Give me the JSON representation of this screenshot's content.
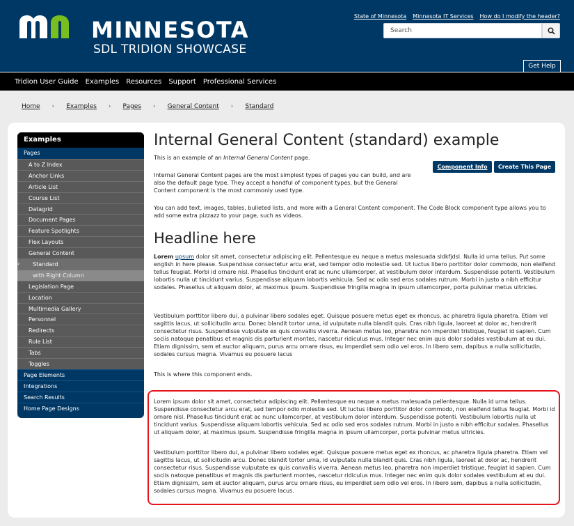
{
  "header": {
    "brand_name": "MINNESOTA",
    "brand_sub": "SDL TRIDION SHOWCASE",
    "util_links": [
      "State of Minnesota",
      "Minnesota IT Services",
      "How do I modify the header?"
    ],
    "search_placeholder": "Search",
    "get_help": "Get Help",
    "logo_colors": {
      "m": "#ffffff",
      "n": "#78be20"
    }
  },
  "nav": [
    "Tridion User Guide",
    "Examples",
    "Resources",
    "Support",
    "Professional Services"
  ],
  "breadcrumb": [
    "Home",
    "Examples",
    "Pages",
    "General Content",
    "Standard"
  ],
  "sidebar": {
    "heading": "Examples",
    "pages": "Pages",
    "sub_items": [
      "A to Z Index",
      "Anchor Links",
      "Article List",
      "Course List",
      "Datagrid",
      "Document Pages",
      "Feature Spotlights",
      "Flex Layouts",
      "General Content"
    ],
    "current": "Standard",
    "current_child": "with Right Column",
    "more_items": [
      "Legislation Page",
      "Location",
      "Multimedia Gallery",
      "Personnel",
      "Redirects",
      "Rule List",
      "Tabs",
      "Toggles"
    ],
    "top_items": [
      "Page Elements",
      "Integrations",
      "Search Results",
      "Home Page Designs"
    ]
  },
  "content": {
    "title": "Internal General Content (standard) example",
    "intro_prefix": "This is an example of an ",
    "intro_italic": "Internal General Content",
    "intro_suffix": " page.",
    "desc": "Internal General Content pages are the most simplest types of pages you can build, and are also the default page type. They accept a handful of component types, but the General Content component is the most commonly used type.",
    "component_info_btn": "Component Info",
    "create_page_btn": "Create This Page",
    "add_text": "You can add text, images, tables, bulleted lists, and more with a General Content component. The Code Block component type allows you to add some extra pizzazz to your page, such as videos.",
    "headline": "Headline here",
    "lorem_bold": "Lorem",
    "lorem_link": "upsum",
    "lorem_rest": " dolor sit amet, consectetur adipiscing elit. Pellentesque eu neque a metus malesuada sldkfjdsl. Nulla id urna tellus.  Put some english in here please. Suspendisse consectetur arcu erat, sed tempor odio molestie sed. Ut luctus libero porttitor dolor commodo, non eleifend tellus feugiat. Morbi id ornare nisl. Phasellus tincidunt erat ac nunc ullamcorper, at vestibulum dolor interdum. Suspendisse potenti. Vestibulum lobortis nulla ut tincidunt varius. Suspendisse aliquam lobortis vehicula. Sed ac odio sed eros sodales rutrum. Morbi in justo a nibh efficitur sodales. Phasellus ut aliquam dolor, at maximus ipsum. Suspendisse fringilla magna in ipsum ullamcorper, porta pulvinar metus ultricies.",
    "vestibulum": "Vestibulum porttitor libero dui, a pulvinar libero sodales eget. Quisque posuere metus eget ex rhoncus, ac pharetra ligula pharetra. Etiam vel sagittis lacus, ut sollicitudin arcu. Donec blandit tortor urna, id vulputate nulla blandit quis. Cras nibh ligula, laoreet at dolor ac, hendrerit consectetur risus. Suspendisse vulputate ex quis convallis viverra. Aenean metus leo, pharetra non imperdiet tristique, feugiat id sapien. Cum sociis natoque penatibus et magnis dis parturient montes, nascetur ridiculus mus. Integer nec enim quis dolor sodales vestibulum at eu dui. Etiam dignissim, sem et auctor aliquam, purus arcu ornare risus, eu imperdiet sem odio vel eros. In libero sem, dapibus a nulla sollicitudin, sodales cursus magna. Vivamus eu posuere lacus",
    "component_ends": "This is where this component ends.",
    "box_lorem": "Lorem ipsum dolor sit amet, consectetur adipiscing elit. Pellentesque eu neque a metus malesuada pellentesque. Nulla id urna tellus. Suspendisse consectetur arcu erat, sed tempor odio molestie sed. Ut luctus libero porttitor dolor commodo, non eleifend tellus feugiat. Morbi id ornare nisl. Phasellus tincidunt erat ac nunc ullamcorper, at vestibulum dolor interdum. Suspendisse potenti. Vestibulum lobortis nulla ut tincidunt varius. Suspendisse aliquam lobortis vehicula. Sed ac odio sed eros sodales rutrum. Morbi in justo a nibh efficitur sodales. Phasellus ut aliquam dolor, at maximus ipsum. Suspendisse fringilla magna in ipsum ullamcorper, porta pulvinar metus ultricies.",
    "box_vestibulum": "Vestibulum porttitor libero dui, a pulvinar libero sodales eget. Quisque posuere metus eget ex rhoncus, ac pharetra ligula pharetra. Etiam vel sagittis lacus, ut sollicitudin arcu. Donec blandit tortor urna, id vulputate nulla blandit quis. Cras nibh ligula, laoreet at dolor ac, hendrerit consectetur risus. Suspendisse vulputate ex quis convallis viverra. Aenean metus leo, pharetra non imperdiet tristique, feugiat id sapien. Cum sociis natoque penatibus et magnis dis parturient montes, nascetur ridiculus mus. Integer nec enim quis dolor sodales vestibulum at eu dui. Etiam dignissim, sem et auctor aliquam, purus arcu ornare risus, eu imperdiet sem odio vel eros. In libero sem, dapibus a nulla sollicitudin, sodales cursus magna. Vivamus eu posuere lacus."
  },
  "colors": {
    "brand_blue": "#003865",
    "nav_black": "#000000",
    "highlight_red": "#e6121c",
    "sidebar_gray": "#595959"
  }
}
